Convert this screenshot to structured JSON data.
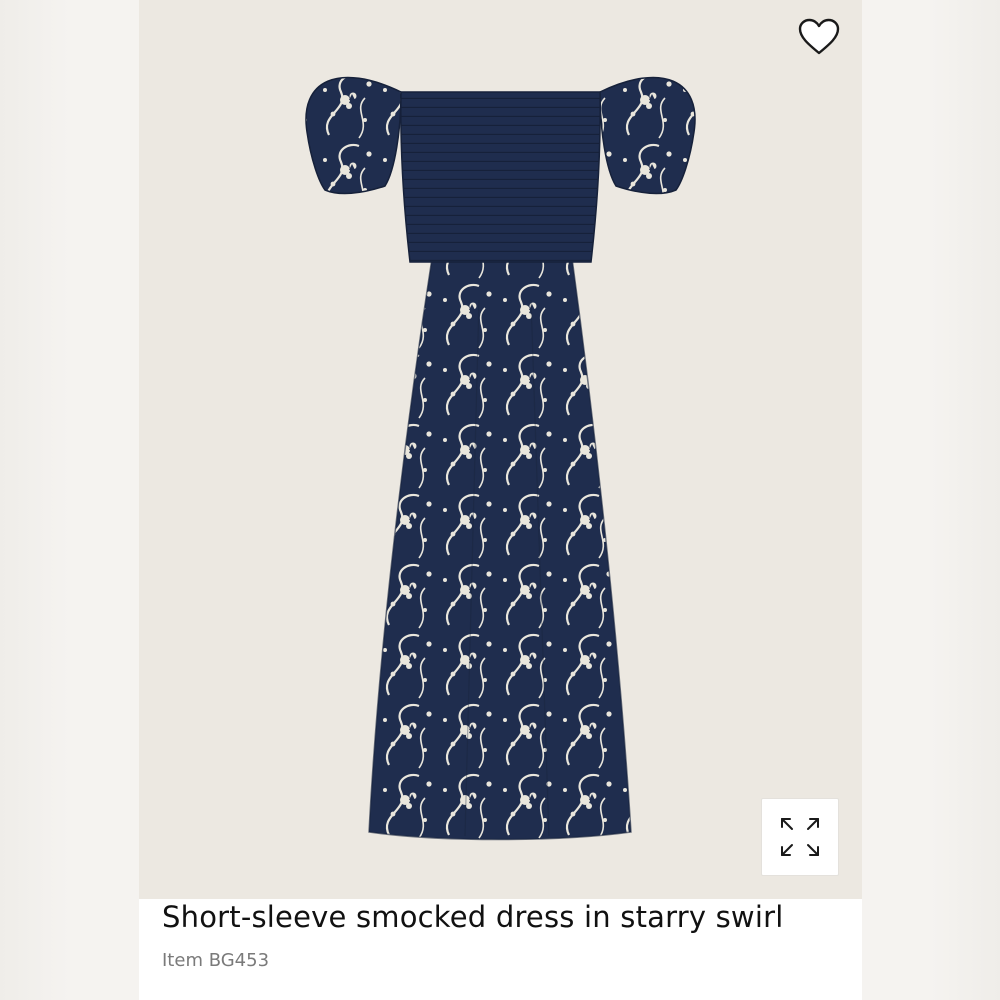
{
  "product": {
    "title": "Short-sleeve smocked dress in starry swirl",
    "item_code": "Item BG453",
    "print_color": "#1f2d4e",
    "motif_color": "#e9e6dc"
  },
  "icons": {
    "wishlist": "heart-outline-icon",
    "expand": "expand-arrows-icon"
  }
}
